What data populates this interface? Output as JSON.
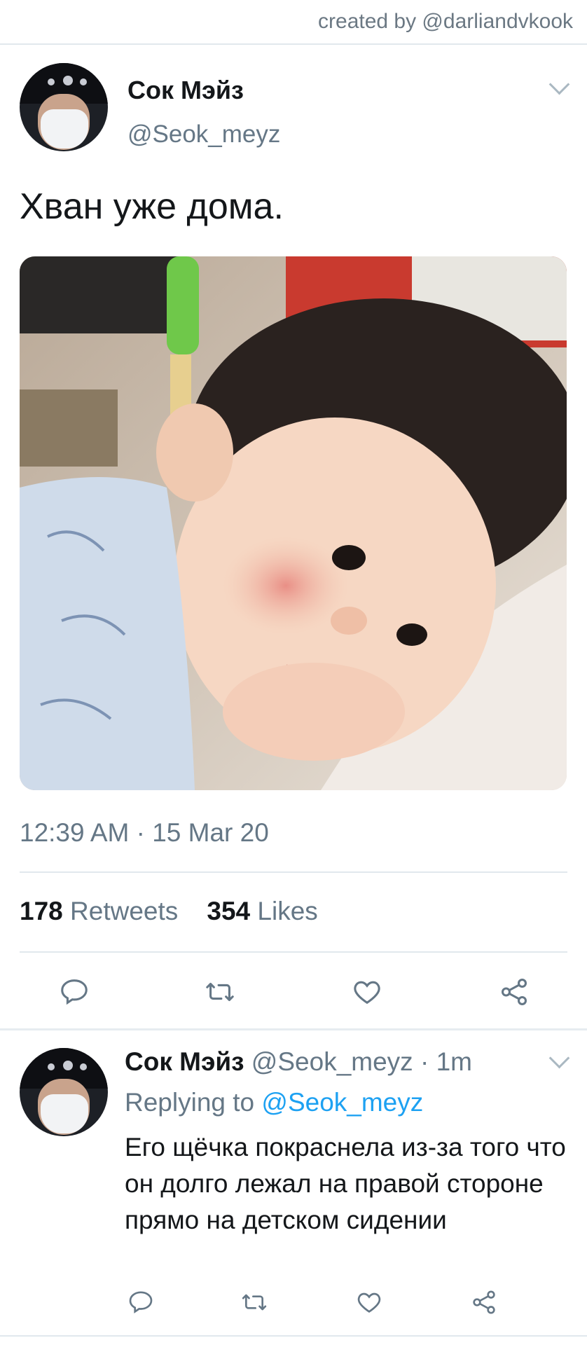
{
  "credit": "created by @darliandvkook",
  "main_tweet": {
    "name": "Сок Мэйз",
    "handle": "@Seok_meyz",
    "text": "Хван уже дома.",
    "photo_description_icon": "photo",
    "timestamp": "12:39 AM · 15 Mar 20",
    "retweets_count": "178",
    "retweets_label": "Retweets",
    "likes_count": "354",
    "likes_label": "Likes"
  },
  "actions": [
    "reply-icon",
    "retweet-icon",
    "like-icon",
    "share-icon"
  ],
  "reply_tweet": {
    "name": "Сок Мэйз",
    "handle": "@Seok_meyz",
    "separator": "·",
    "time": "1m",
    "replying_prefix": "Replying to",
    "replying_handle": "@Seok_meyz",
    "text": "Его щёчка покраснела из-за того что он долго лежал на правой стороне прямо на детском сидении"
  },
  "colors": {
    "accent": "#1da1f2",
    "secondary_text": "#657786",
    "divider": "#e1e8ed"
  }
}
